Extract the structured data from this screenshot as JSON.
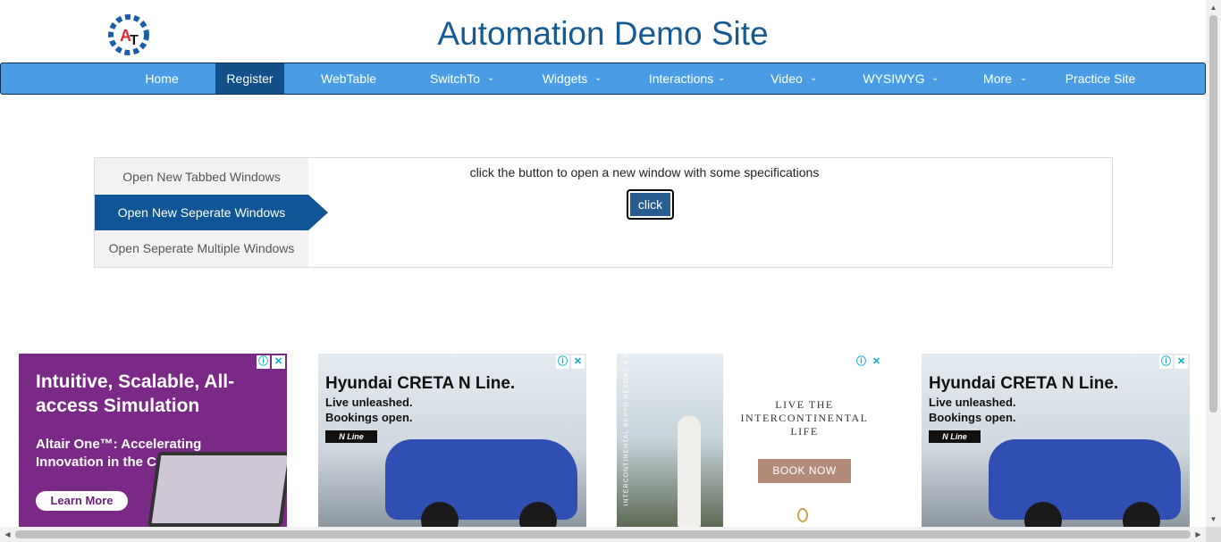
{
  "header": {
    "title": "Automation Demo Site",
    "logo_letters": "AT"
  },
  "nav": {
    "items": [
      {
        "label": "Home",
        "dropdown": false,
        "active": false
      },
      {
        "label": "Register",
        "dropdown": false,
        "active": true
      },
      {
        "label": "WebTable",
        "dropdown": false,
        "active": false
      },
      {
        "label": "SwitchTo",
        "dropdown": true,
        "active": false
      },
      {
        "label": "Widgets",
        "dropdown": true,
        "active": false
      },
      {
        "label": "Interactions",
        "dropdown": true,
        "active": false
      },
      {
        "label": "Video",
        "dropdown": true,
        "active": false
      },
      {
        "label": "WYSIWYG",
        "dropdown": true,
        "active": false
      },
      {
        "label": "More",
        "dropdown": true,
        "active": false
      },
      {
        "label": "Practice Site",
        "dropdown": false,
        "active": false
      }
    ],
    "chevron": "⌄"
  },
  "tabs": {
    "items": [
      {
        "label": "Open New Tabbed Windows",
        "active": false
      },
      {
        "label": "Open New Seperate Windows",
        "active": true
      },
      {
        "label": "Open Seperate Multiple Windows",
        "active": false
      }
    ],
    "description": "click the button to open a new window with some specifications",
    "button_label": "click"
  },
  "ads": {
    "badge_info": "ⓘ",
    "badge_close": "✕",
    "ad1": {
      "headline": "Intuitive, Scalable, All-access Simulation",
      "subhead": "Altair One™: Accelerating Innovation in the Cloud™",
      "cta": "Learn More"
    },
    "creta": {
      "headline": "Hyundai CRETA N Line.",
      "tagline_1": "Live unleashed.",
      "tagline_2": "Bookings open.",
      "badge": "N Line"
    },
    "ad3": {
      "vertical_text": "INTERCONTINENTAL BEPPU RESORT & SPA",
      "headline_1": "LIVE THE",
      "headline_2": "INTERCONTINENTAL",
      "headline_3": "LIFE",
      "cta": "BOOK NOW"
    }
  },
  "colors": {
    "nav_bg": "#4a9de4",
    "nav_active": "#13508a",
    "title": "#155a93",
    "tab_active": "#105595"
  }
}
